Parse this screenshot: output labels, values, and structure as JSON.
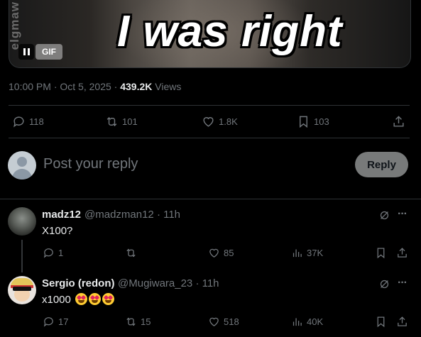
{
  "media": {
    "caption": "I was right",
    "watermark": "elgmaw",
    "gif_label": "GIF"
  },
  "post_meta": {
    "time": "10:00 PM",
    "sep": "·",
    "date": "Oct 5, 2025",
    "views_count": "439.2K",
    "views_label": "Views"
  },
  "actions": {
    "replies": "118",
    "reposts": "101",
    "likes": "1.8K",
    "bookmarks": "103"
  },
  "compose": {
    "placeholder": "Post your reply",
    "button": "Reply"
  },
  "replies": [
    {
      "name": "madz12",
      "handle": "@madzman12",
      "time": "· 11h",
      "text": "X100?",
      "stats": {
        "replies": "1",
        "reposts": "",
        "likes": "85",
        "views": "37K"
      }
    },
    {
      "name": "Sergio (redon)",
      "handle": "@Mugiwara_23",
      "time": "· 11h",
      "text": "x1000",
      "emoji": "heart-eyes-emoji",
      "stats": {
        "replies": "17",
        "reposts": "15",
        "likes": "518",
        "views": "40K"
      }
    }
  ],
  "colors": {
    "bg": "#000000",
    "text": "#e7e9ea",
    "muted": "#71767b",
    "divider": "#2f3336"
  }
}
